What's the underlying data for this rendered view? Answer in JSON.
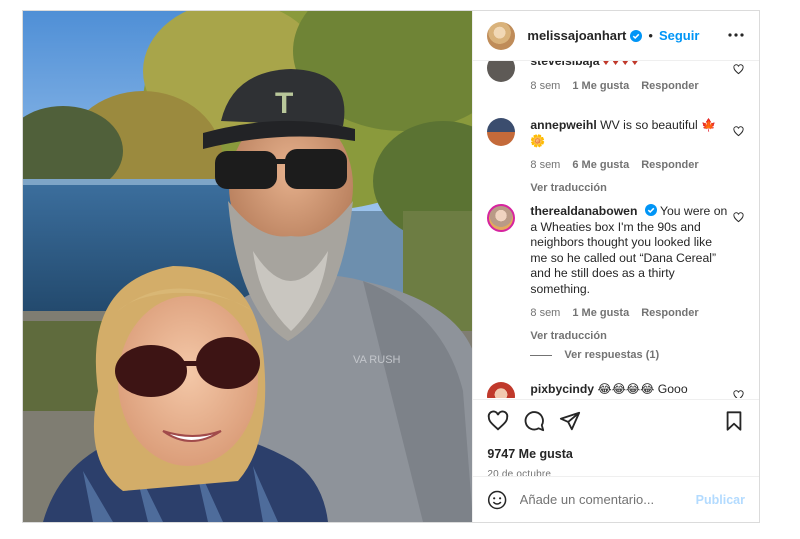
{
  "header": {
    "username": "melissajoanhart",
    "separator": "•",
    "follow_label": "Seguir",
    "avatar_icon": "user-avatar",
    "verified_icon": "verified-badge-icon",
    "more_icon": "more-options-icon"
  },
  "comments": [
    {
      "user": "stevelsibaja",
      "text": "♦ ♦ ♦ ♦",
      "time": "8 sem",
      "likes": "1 Me gusta",
      "reply": "Responder",
      "translate": ""
    },
    {
      "user": "annepweihl",
      "text": "WV is so beautiful 🍁🌼",
      "time": "8 sem",
      "likes": "6 Me gusta",
      "reply": "Responder",
      "translate": "Ver traducción"
    },
    {
      "user": "therealdanabowen",
      "text": "You were on a Wheaties box I'm the 90s and neighbors thought you looked like me so he called out “Dana Cereal” and he still does as a thirty something.",
      "time": "8 sem",
      "likes": "1 Me gusta",
      "reply": "Responder",
      "translate": "Ver traducción",
      "replies_label": "Ver respuestas (1)"
    },
    {
      "user": "pixbycindy",
      "text": "😂😂😂😂 Gooo",
      "time": "",
      "likes": "",
      "reply": "",
      "translate": ""
    }
  ],
  "actions": {
    "like_icon": "heart-icon",
    "comment_icon": "comment-icon",
    "share_icon": "share-icon",
    "save_icon": "bookmark-icon",
    "likes_count": "9747 Me gusta",
    "date": "20 de octubre"
  },
  "add_comment": {
    "placeholder": "Añade un comentario...",
    "publish_label": "Publicar",
    "emoji_icon": "emoji-icon"
  },
  "photo": {
    "cap_logo": "T",
    "shirt_text": "VA RUSH"
  },
  "colors": {
    "link_blue": "#0095f6",
    "publish_disabled": "#b3dbff",
    "secondary_text": "#737373"
  }
}
